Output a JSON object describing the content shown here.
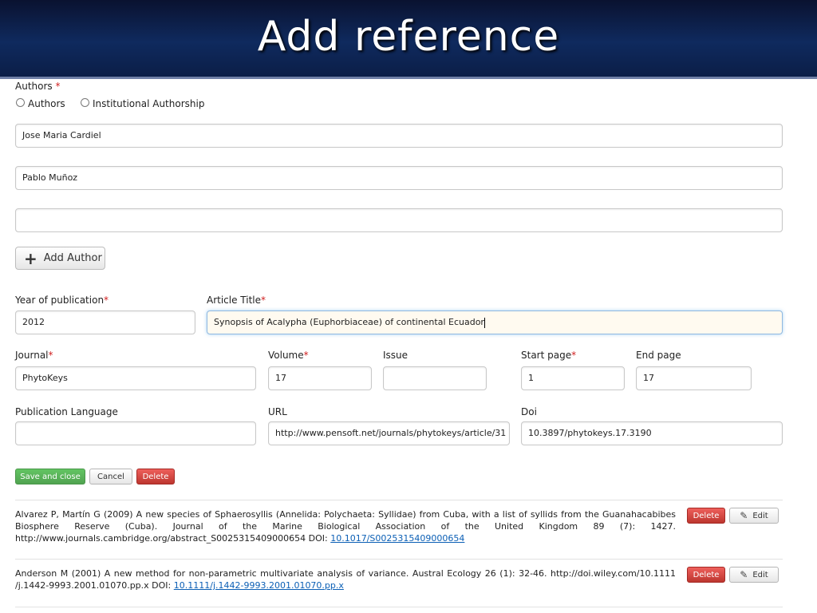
{
  "header": {
    "title": "Add reference"
  },
  "authors": {
    "label": "Authors",
    "required_mark": "*",
    "radio_authors": "Authors",
    "radio_institutional": "Institutional Authorship",
    "fields": [
      "Jose Maria Cardiel",
      "Pablo Muñoz",
      ""
    ],
    "add_button": "Add Author"
  },
  "form": {
    "year": {
      "label": "Year of publication",
      "value": "2012"
    },
    "title": {
      "label": "Article Title",
      "value": "Synopsis of Acalypha (Euphorbiaceae) of continental Ecuador"
    },
    "journal": {
      "label": "Journal",
      "value": "PhytoKeys"
    },
    "volume": {
      "label": "Volume",
      "value": "17"
    },
    "issue": {
      "label": "Issue",
      "value": ""
    },
    "start_page": {
      "label": "Start page",
      "value": "1"
    },
    "end_page": {
      "label": "End page",
      "value": "17"
    },
    "language": {
      "label": "Publication Language",
      "value": ""
    },
    "url": {
      "label": "URL",
      "value": "http://www.pensoft.net/journals/phytokeys/article/31"
    },
    "doi": {
      "label": "Doi",
      "value": "10.3897/phytokeys.17.3190"
    },
    "required_mark": "*"
  },
  "actions": {
    "save": "Save and close",
    "cancel": "Cancel",
    "delete": "Delete"
  },
  "references": [
    {
      "text": "Alvarez P, Martín G (2009) A new species of Sphaerosyllis (Annelida: Polychaeta: Syllidae) from Cuba, with a list of syllids from the Guanahacabibes Biosphere Reserve (Cuba). Journal of the Marine Biological Association of the United Kingdom 89 (7): 1427. http://www.journals.cambridge.org/abstract_S0025315409000654 DOI: ",
      "doi_link": "10.1017/S0025315409000654",
      "delete": "Delete",
      "edit": "Edit"
    },
    {
      "text": "Anderson M (2001) A new method for non-parametric multivariate analysis of variance. Austral Ecology 26 (1): 32-46. http://doi.wiley.com/10.1111 /j.1442-9993.2001.01070.pp.x DOI: ",
      "doi_link": "10.1111/j.1442-9993.2001.01070.pp.x",
      "delete": "Delete",
      "edit": "Edit"
    }
  ],
  "colors": {
    "banner": "#0f2a5e",
    "required": "#d02020",
    "save": "#51a351",
    "delete": "#bd362f",
    "link": "#0b5fb5"
  }
}
